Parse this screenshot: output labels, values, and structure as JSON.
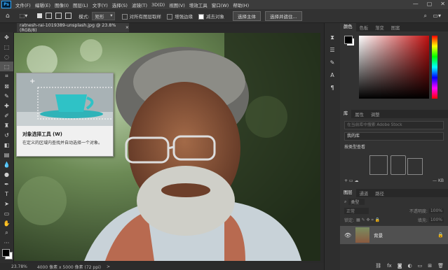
{
  "menubar": {
    "logo": "Ps",
    "items": [
      "文件(F)",
      "编辑(E)",
      "图像(I)",
      "图层(L)",
      "文字(Y)",
      "选择(S)",
      "滤镜(T)",
      "3D(D)",
      "视图(V)",
      "增效工具",
      "窗口(W)",
      "帮助(H)"
    ],
    "controls": [
      "—",
      "▢",
      "✕"
    ]
  },
  "options": {
    "mode_label": "模式:",
    "mode_value": "矩形",
    "sample_all": "对所有图层取样",
    "enhance_edge": "增强边缘",
    "subtract": "减去对象",
    "select_subject": "选择主体",
    "select_and_mask": "选择并遮住..."
  },
  "document": {
    "tab_title": "ratnesh-rai-1019389-unsplash.jpg @ 23.8%(RGB/8)",
    "close": "×"
  },
  "tooltip": {
    "title": "对象选择工具 (W)",
    "description": "在定义的区域内查找并自动选择一个对象。"
  },
  "status": {
    "zoom": "23.78%",
    "info": "4000 像素 x 5000 像素 (72 ppi)",
    "arrow": ">"
  },
  "panels": {
    "color_tabs": [
      "颜色",
      "色板",
      "渐变",
      "图案"
    ],
    "library_tabs": [
      "库",
      "属性",
      "调整"
    ],
    "library_search_placeholder": "在当前库中搜索 Adobe Stock",
    "library_name": "我的库",
    "library_view": "按类型查看",
    "library_size": "— KB",
    "layers_tabs": [
      "图层",
      "通道",
      "路径"
    ],
    "layers_filter": "类型",
    "layers_mode": "正常",
    "layers_opacity_label": "不透明度:",
    "layers_opacity": "100%",
    "layers_lock_label": "锁定:",
    "layers_fill_label": "填充:",
    "layers_fill": "100%",
    "layer_name": "背景",
    "bottom_icons": [
      "fx-icon",
      "mask-icon",
      "adjustment-icon",
      "folder-icon",
      "new-layer-icon",
      "trash-icon"
    ]
  },
  "colors": {
    "accent": "#31a8ff",
    "menubar_bg": "#3c3c3c",
    "panel_bg": "#323232"
  }
}
